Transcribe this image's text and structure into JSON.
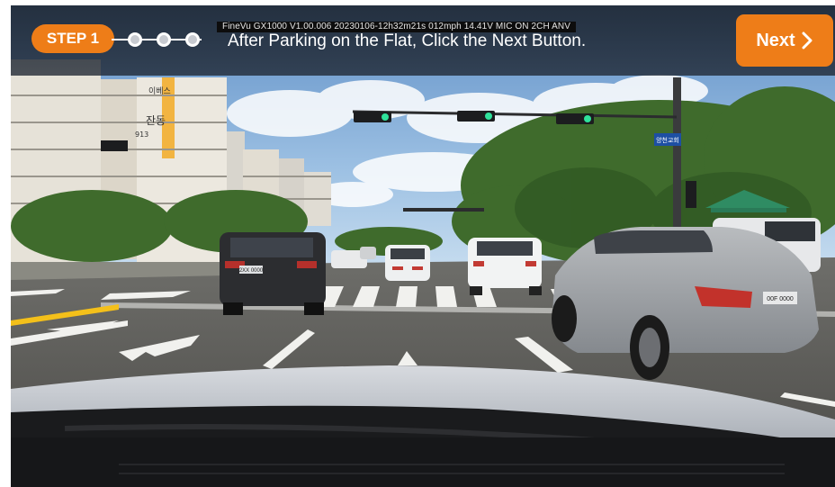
{
  "overlay": {
    "osd_text": "FineVu GX1000 V1.00.006  20230106-12h32m21s  012mph 14.41V MIC ON 2CH ANV",
    "step_label": "STEP 1",
    "instruction": "After Parking on the Flat, Click the Next Button.",
    "next_label": "Next",
    "progress": {
      "current_step": 1,
      "total_steps": 4
    }
  },
  "icons": {
    "next": "chevron-right-icon",
    "progress_dots": "step-progress-dots-icon"
  },
  "scene": {
    "plates": [
      "2XX 0000",
      "00F 0000"
    ],
    "road_sign": "양천교회",
    "building_signs": [
      "이베스",
      "잔동",
      "913"
    ]
  },
  "colors": {
    "accent": "#ee7d18",
    "bar": "#1e2633",
    "osd_bg": "#0d0d0d",
    "signal_green": "#2fe29b",
    "sky": "#7aa6d6"
  }
}
